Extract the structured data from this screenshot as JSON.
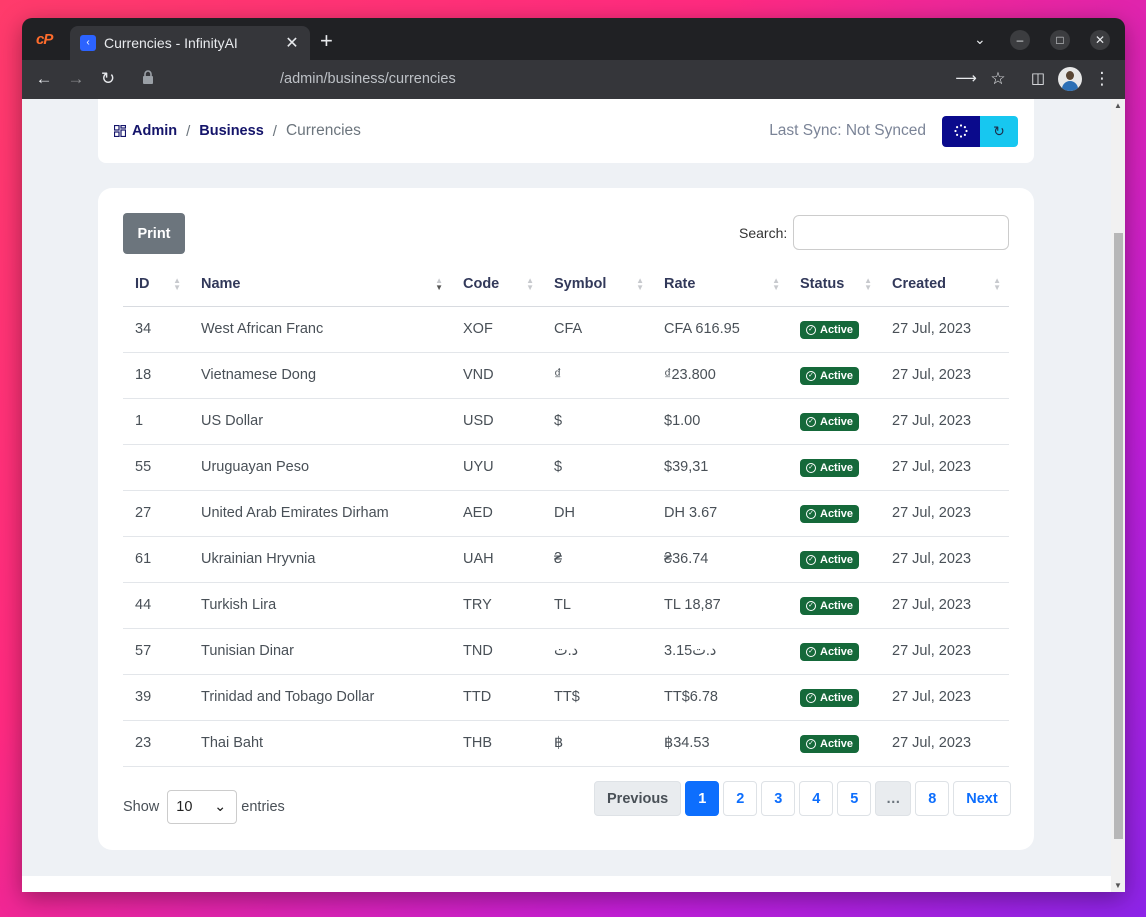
{
  "browser": {
    "tab_title": "Currencies - InfinityAI",
    "url": "/admin/business/currencies"
  },
  "breadcrumb": {
    "items": [
      {
        "label": "Admin"
      },
      {
        "label": "Business"
      }
    ],
    "current": "Currencies",
    "separator": "/"
  },
  "sync": {
    "text": "Last Sync: Not Synced"
  },
  "toolbar": {
    "print_label": "Print",
    "search_label": "Search:",
    "search_value": ""
  },
  "table": {
    "columns": [
      "ID",
      "Name",
      "Code",
      "Symbol",
      "Rate",
      "Status",
      "Created"
    ],
    "rows": [
      {
        "id": "34",
        "name": "West African Franc",
        "code": "XOF",
        "symbol": "CFA",
        "rate": "CFA 616.95",
        "status": "Active",
        "created": "27 Jul, 2023"
      },
      {
        "id": "18",
        "name": "Vietnamese Dong",
        "code": "VND",
        "symbol": "₫",
        "rate": "₫23.800",
        "status": "Active",
        "created": "27 Jul, 2023"
      },
      {
        "id": "1",
        "name": "US Dollar",
        "code": "USD",
        "symbol": "$",
        "rate": "$1.00",
        "status": "Active",
        "created": "27 Jul, 2023"
      },
      {
        "id": "55",
        "name": "Uruguayan Peso",
        "code": "UYU",
        "symbol": "$",
        "rate": "$39,31",
        "status": "Active",
        "created": "27 Jul, 2023"
      },
      {
        "id": "27",
        "name": "United Arab Emirates Dirham",
        "code": "AED",
        "symbol": "DH",
        "rate": "DH 3.67",
        "status": "Active",
        "created": "27 Jul, 2023"
      },
      {
        "id": "61",
        "name": "Ukrainian Hryvnia",
        "code": "UAH",
        "symbol": "₴",
        "rate": "₴36.74",
        "status": "Active",
        "created": "27 Jul, 2023"
      },
      {
        "id": "44",
        "name": "Turkish Lira",
        "code": "TRY",
        "symbol": "TL",
        "rate": "TL 18,87",
        "status": "Active",
        "created": "27 Jul, 2023"
      },
      {
        "id": "57",
        "name": "Tunisian Dinar",
        "code": "TND",
        "symbol": "د.ت",
        "rate": "3.15د.ت",
        "status": "Active",
        "created": "27 Jul, 2023"
      },
      {
        "id": "39",
        "name": "Trinidad and Tobago Dollar",
        "code": "TTD",
        "symbol": "TT$",
        "rate": "TT$6.78",
        "status": "Active",
        "created": "27 Jul, 2023"
      },
      {
        "id": "23",
        "name": "Thai Baht",
        "code": "THB",
        "symbol": "฿",
        "rate": "฿34.53",
        "status": "Active",
        "created": "27 Jul, 2023"
      }
    ]
  },
  "length": {
    "show_label": "Show",
    "value": "10",
    "entries_label": "entries"
  },
  "pagination": {
    "previous": "Previous",
    "pages": [
      "1",
      "2",
      "3",
      "4",
      "5"
    ],
    "ellipsis": "…",
    "last": "8",
    "next": "Next",
    "active": "1"
  },
  "colors": {
    "active_badge": "#15693a",
    "primary": "#0d6efd",
    "breadcrumb_link": "#14146a",
    "sync_dark": "#0a0a8c",
    "sync_light": "#17c7f0"
  }
}
